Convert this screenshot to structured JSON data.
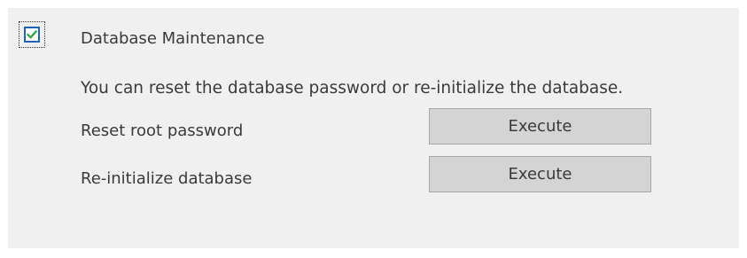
{
  "section": {
    "title": "Database Maintenance",
    "enabled": true,
    "description": "You can reset the database password or re-initialize the database."
  },
  "actions": [
    {
      "label": "Reset root password",
      "button_label": "Execute"
    },
    {
      "label": "Re-initialize database",
      "button_label": "Execute"
    }
  ],
  "colors": {
    "panel_background": "#f0f0f0",
    "button_background": "#d4d4d4",
    "checkbox_border": "#1f64b5",
    "checkmark": "#2e9e3a"
  }
}
